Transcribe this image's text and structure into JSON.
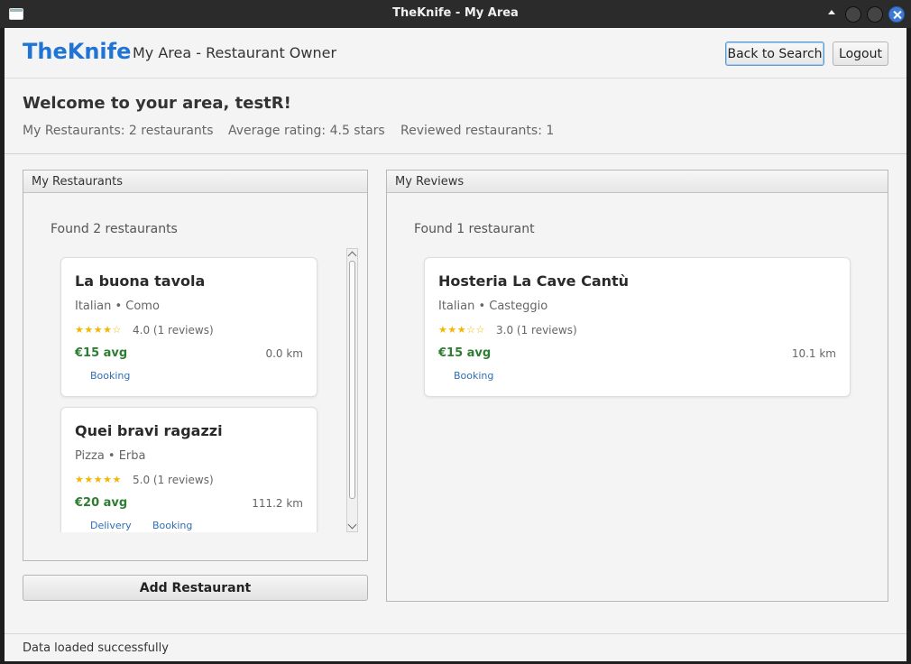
{
  "window": {
    "title": "TheKnife - My Area"
  },
  "header": {
    "brand": "TheKnife",
    "subtitle": "My Area - Restaurant Owner",
    "back_label": "Back to Search",
    "logout_label": "Logout"
  },
  "welcome": {
    "title": "Welcome to your area, testR!",
    "stat_restaurants": "My Restaurants: 2 restaurants",
    "stat_rating": "Average rating: 4.5 stars",
    "stat_reviewed": "Reviewed restaurants: 1"
  },
  "my_restaurants": {
    "panel_title": "My Restaurants",
    "found": "Found 2 restaurants",
    "items": [
      {
        "name": "La buona tavola",
        "category": "Italian • Como",
        "stars": "★★★★☆",
        "rating": "4.0 (1 reviews)",
        "price": "€15 avg",
        "distance": "0.0 km",
        "tags": [
          "Booking"
        ]
      },
      {
        "name": "Quei bravi ragazzi",
        "category": "Pizza • Erba",
        "stars": "★★★★★",
        "rating": "5.0 (1 reviews)",
        "price": "€20 avg",
        "distance": "111.2 km",
        "tags": [
          "Delivery",
          "Booking"
        ]
      }
    ],
    "add_label": "Add Restaurant"
  },
  "my_reviews": {
    "panel_title": "My Reviews",
    "found": "Found 1 restaurant",
    "items": [
      {
        "name": "Hosteria La Cave Cantù",
        "category": "Italian • Casteggio",
        "stars": "★★★☆☆",
        "rating": "3.0 (1 reviews)",
        "price": "€15 avg",
        "distance": "10.1 km",
        "tags": [
          "Booking"
        ]
      }
    ]
  },
  "status": {
    "message": "Data loaded successfully"
  },
  "colors": {
    "brand": "#1f74d6",
    "price": "#2e7d32",
    "star": "#f2b705",
    "tag": "#2f6fb5"
  }
}
